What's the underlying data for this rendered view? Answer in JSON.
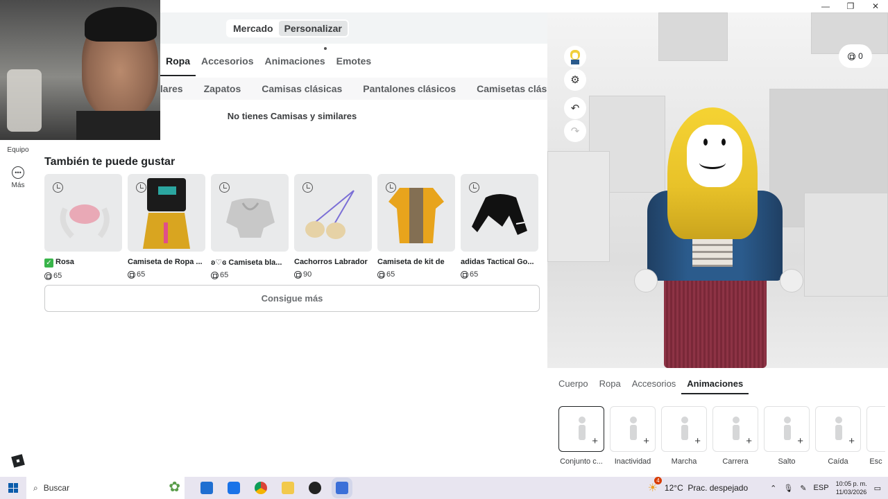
{
  "window": {
    "minimize": "—",
    "maximize": "❐",
    "close": "✕"
  },
  "top_switch": {
    "market": "Mercado",
    "customize": "Personalizar"
  },
  "category_tabs": [
    "Ropa",
    "Accesorios",
    "Animaciones",
    "Emotes"
  ],
  "subcategory_tabs": [
    "ilares",
    "Zapatos",
    "Camisas clásicas",
    "Pantalones clásicos",
    "Camisetas clásicas"
  ],
  "empty_message": "No tienes Camisas y similares",
  "sidebar": {
    "equipment": "Equipo",
    "more": "Más"
  },
  "recommendations": {
    "title": "También te puede gustar",
    "items": [
      {
        "name": "Rosa",
        "price": "65",
        "owned": true
      },
      {
        "name": "Camiseta de Ropa ...",
        "price": "65",
        "owned": false
      },
      {
        "name": "ʚ♡ɞ Camiseta bla...",
        "price": "65",
        "owned": false
      },
      {
        "name": "Cachorros Labrador",
        "price": "90",
        "owned": false
      },
      {
        "name": "Camiseta de kit de",
        "price": "65",
        "owned": false
      },
      {
        "name": "adidas Tactical Go...",
        "price": "65",
        "owned": false
      }
    ],
    "more_button": "Consigue más"
  },
  "avatar_panel": {
    "robux_balance": "0",
    "tools": {
      "undo": "↶",
      "redo": "↷"
    },
    "tabs": [
      "Cuerpo",
      "Ropa",
      "Accesorios",
      "Animaciones"
    ],
    "animations": [
      "Conjunto c...",
      "Inactividad",
      "Marcha",
      "Carrera",
      "Salto",
      "Caída",
      "Esc"
    ]
  },
  "taskbar": {
    "search_placeholder": "Buscar",
    "weather": "12°C  Prac. despejado",
    "language": "ESP",
    "time": "10:05 p. m.",
    "date": "11/03/2026",
    "weather_badge": "4"
  },
  "colors": {
    "accent": "#202325",
    "panel_bg": "#f2f4f5",
    "taskbar": "#e8e5f0",
    "owned_check": "#39b54a"
  }
}
